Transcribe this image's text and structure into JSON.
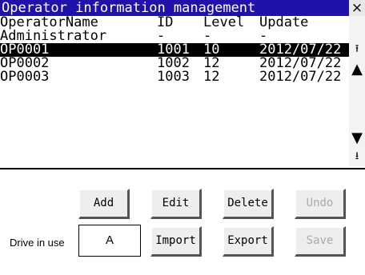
{
  "window": {
    "title": "Operator information management",
    "close_label": "×"
  },
  "table": {
    "headers": {
      "name": "OperatorName",
      "id": "ID",
      "level": "Level",
      "update": "Update"
    },
    "rows": [
      {
        "name": "Administrator",
        "id": "-",
        "level": "-",
        "update": "-"
      },
      {
        "name": "OP0001",
        "id": "1001",
        "level": "10",
        "update": "2012/07/22"
      },
      {
        "name": "OP0002",
        "id": "1002",
        "level": "12",
        "update": "2012/07/22"
      },
      {
        "name": "OP0003",
        "id": "1003",
        "level": "12",
        "update": "2012/07/22"
      }
    ],
    "selected_row": "OP0001"
  },
  "scrollbar": {
    "top_glyph": "⭱",
    "up_glyph": "▲",
    "down_glyph": "▼",
    "bottom_glyph": "⭳"
  },
  "buttons": {
    "add": "Add",
    "edit": "Edit",
    "delete": "Delete",
    "undo": "Undo",
    "import": "Import",
    "export": "Export",
    "save": "Save"
  },
  "drive": {
    "label": "Drive in use",
    "value": "A"
  },
  "colors": {
    "title_bar": "#1e12aa",
    "selection": "#000000",
    "disabled_text": "#aaaaaa"
  }
}
